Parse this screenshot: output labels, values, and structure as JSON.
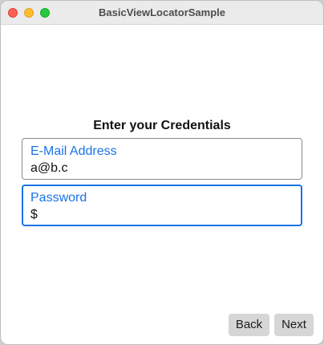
{
  "window": {
    "title": "BasicViewLocatorSample"
  },
  "form": {
    "heading": "Enter your Credentials",
    "email": {
      "label": "E-Mail Address",
      "value": "a@b.c"
    },
    "password": {
      "label": "Password",
      "value": "$"
    }
  },
  "buttons": {
    "back": "Back",
    "next": "Next"
  },
  "colors": {
    "accent": "#1a73e8",
    "button_bg": "#d6d6d6",
    "close": "#fe5f57",
    "minimize": "#febc2e",
    "zoom": "#28c840"
  }
}
